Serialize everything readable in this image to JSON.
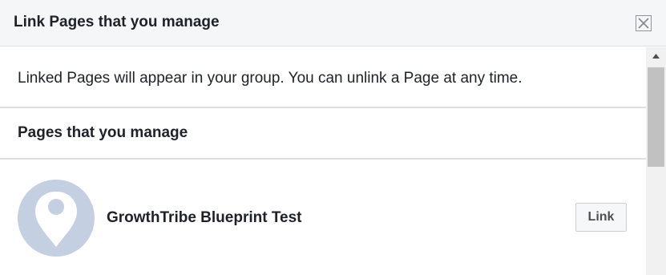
{
  "dialog": {
    "title": "Link Pages that you manage",
    "close_icon": "close-icon"
  },
  "info": {
    "text": "Linked Pages will appear in your group. You can unlink a Page at any time."
  },
  "section": {
    "title": "Pages that you manage"
  },
  "pages": [
    {
      "name": "GrowthTribe Blueprint Test",
      "avatar_icon": "location-pin-icon",
      "button_label": "Link"
    }
  ],
  "colors": {
    "header_background": "#f5f6f7",
    "text": "#1d2129",
    "avatar_background": "#c5cfe2",
    "divider": "#dddfe2"
  }
}
